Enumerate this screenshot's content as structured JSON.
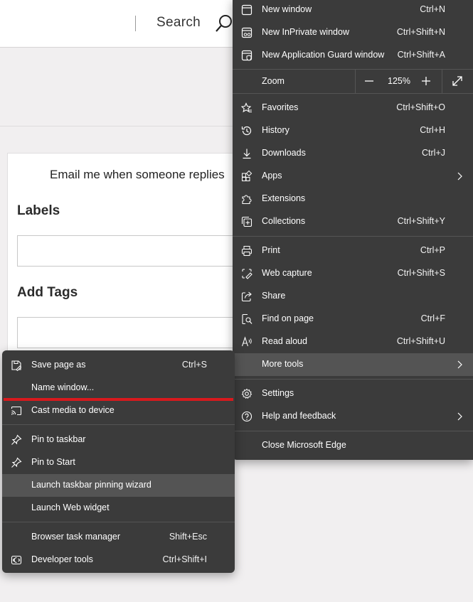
{
  "page": {
    "search_label": "Search",
    "email_text": "Email me when someone replies",
    "labels_heading": "Labels",
    "tags_heading": "Add Tags"
  },
  "main_menu": {
    "items": [
      {
        "label": "New window",
        "shortcut": "Ctrl+N",
        "icon": "new-window-icon"
      },
      {
        "label": "New InPrivate window",
        "shortcut": "Ctrl+Shift+N",
        "icon": "inprivate-icon"
      },
      {
        "label": "New Application Guard window",
        "shortcut": "Ctrl+Shift+A",
        "icon": "application-guard-icon"
      },
      {
        "label": "Favorites",
        "shortcut": "Ctrl+Shift+O",
        "icon": "favorites-icon"
      },
      {
        "label": "History",
        "shortcut": "Ctrl+H",
        "icon": "history-icon"
      },
      {
        "label": "Downloads",
        "shortcut": "Ctrl+J",
        "icon": "downloads-icon"
      },
      {
        "label": "Apps",
        "shortcut": "",
        "icon": "apps-icon"
      },
      {
        "label": "Extensions",
        "shortcut": "",
        "icon": "extensions-icon"
      },
      {
        "label": "Collections",
        "shortcut": "Ctrl+Shift+Y",
        "icon": "collections-icon"
      },
      {
        "label": "Print",
        "shortcut": "Ctrl+P",
        "icon": "print-icon"
      },
      {
        "label": "Web capture",
        "shortcut": "Ctrl+Shift+S",
        "icon": "web-capture-icon"
      },
      {
        "label": "Share",
        "shortcut": "",
        "icon": "share-icon"
      },
      {
        "label": "Find on page",
        "shortcut": "Ctrl+F",
        "icon": "find-icon"
      },
      {
        "label": "Read aloud",
        "shortcut": "Ctrl+Shift+U",
        "icon": "read-aloud-icon"
      },
      {
        "label": "More tools",
        "shortcut": "",
        "icon": ""
      },
      {
        "label": "Settings",
        "shortcut": "",
        "icon": "settings-icon"
      },
      {
        "label": "Help and feedback",
        "shortcut": "",
        "icon": "help-icon"
      },
      {
        "label": "Close Microsoft Edge",
        "shortcut": "",
        "icon": ""
      }
    ],
    "zoom": {
      "label": "Zoom",
      "value": "125%"
    }
  },
  "sub_menu": {
    "items": [
      {
        "label": "Save page as",
        "shortcut": "Ctrl+S",
        "icon": "save-page-icon"
      },
      {
        "label": "Name window...",
        "shortcut": "",
        "icon": ""
      },
      {
        "label": "Cast media to device",
        "shortcut": "",
        "icon": "cast-icon"
      },
      {
        "label": "Pin to taskbar",
        "shortcut": "",
        "icon": "pin-icon"
      },
      {
        "label": "Pin to Start",
        "shortcut": "",
        "icon": "pin-icon"
      },
      {
        "label": "Launch taskbar pinning wizard",
        "shortcut": "",
        "icon": ""
      },
      {
        "label": "Launch Web widget",
        "shortcut": "",
        "icon": ""
      },
      {
        "label": "Browser task manager",
        "shortcut": "Shift+Esc",
        "icon": ""
      },
      {
        "label": "Developer tools",
        "shortcut": "Ctrl+Shift+I",
        "icon": "developer-tools-icon"
      }
    ]
  },
  "colors": {
    "menu_bg": "#3b3b3b",
    "menu_highlight": "#545454",
    "annotation_red": "#d9191d",
    "page_bg": "#f1eff0"
  }
}
